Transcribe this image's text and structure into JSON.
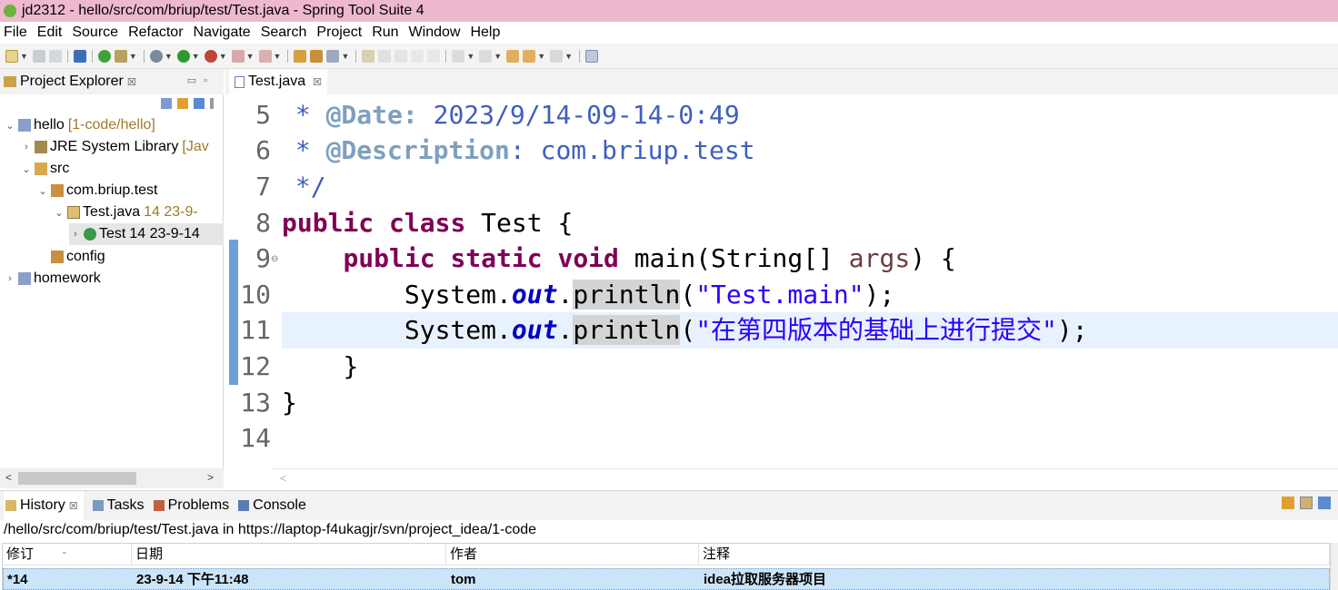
{
  "window": {
    "title": "jd2312 - hello/src/com/briup/test/Test.java - Spring Tool Suite 4"
  },
  "menu": [
    "File",
    "Edit",
    "Source",
    "Refactor",
    "Navigate",
    "Search",
    "Project",
    "Run",
    "Window",
    "Help"
  ],
  "explorer": {
    "tab_label": "Project Explorer",
    "tab_close": "☒",
    "tree": [
      {
        "label": "hello",
        "decoration": "[1-code/hello]",
        "twisty": "⌄",
        "icon": "project-icon"
      },
      {
        "label": "JRE System Library",
        "decoration": "[Jav",
        "twisty": "›",
        "icon": "library-icon"
      },
      {
        "label": "src",
        "decoration": "",
        "twisty": "⌄",
        "icon": "source-folder-icon"
      },
      {
        "label": "com.briup.test",
        "decoration": "",
        "twisty": "⌄",
        "icon": "package-icon"
      },
      {
        "label": "Test.java",
        "decoration": "14  23-9-",
        "twisty": "⌄",
        "icon": "java-file-icon"
      },
      {
        "label": "Test",
        "decoration": "14  23-9-14",
        "twisty": "›",
        "icon": "class-icon"
      },
      {
        "label": "config",
        "decoration": "",
        "twisty": "",
        "icon": "package-icon"
      },
      {
        "label": "homework",
        "decoration": "",
        "twisty": "›",
        "icon": "project-icon"
      }
    ]
  },
  "editor": {
    "tab_label": "Test.java",
    "tab_close": "☒",
    "line_numbers": [
      "5",
      "6",
      "7",
      "8",
      "9",
      "10",
      "11",
      "12",
      "13",
      "14"
    ],
    "tokens": {
      "l5_star": " * ",
      "l5_tag": "@Date:",
      "l5_rest": " 2023/9/14-09-14-0:49",
      "l6_star": " * ",
      "l6_tag": "@Description",
      "l6_rest": ": com.briup.test",
      "l7": " */",
      "kw_public": "public",
      "kw_class": "class",
      "class_name": " Test {",
      "kw_static": "static",
      "kw_void": "void",
      "main_sig": " main(String[] ",
      "param_args": "args",
      "main_end": ") {",
      "system": "System.",
      "out": "out",
      "dot": ".",
      "println": "println",
      "paren_open": "(",
      "str_main": "\"Test.main\"",
      "str_commit": "\"在第四版本的基础上进行提交\"",
      "paren_close": ");",
      "brace_close": "}"
    }
  },
  "bottom_panel": {
    "tabs": [
      {
        "label": "History",
        "close": "☒",
        "active": true
      },
      {
        "label": "Tasks"
      },
      {
        "label": "Problems"
      },
      {
        "label": "Console"
      }
    ],
    "path": "/hello/src/com/briup/test/Test.java in https://laptop-f4ukagjr/svn/project_idea/1-code",
    "history": {
      "columns": [
        "修订",
        "日期",
        "作者",
        "注释"
      ],
      "rows": [
        {
          "revision": "*14",
          "date": "23-9-14 下午11:48",
          "author": "tom",
          "comment": "idea拉取服务器项目"
        }
      ]
    }
  },
  "colors": {
    "title_bar": "#eeb9ce",
    "keyword": "#7f0055",
    "string": "#2a00ff",
    "comment": "#3f5fbf",
    "selection": "#cce4f7"
  }
}
